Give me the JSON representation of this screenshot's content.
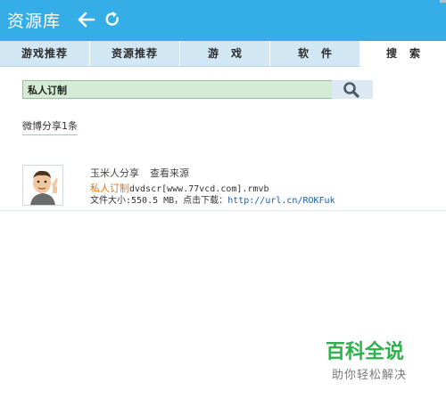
{
  "window": {
    "title": "资源库"
  },
  "tabs": [
    {
      "label": "游戏推荐"
    },
    {
      "label": "资源推荐"
    },
    {
      "label": "游戏"
    },
    {
      "label": "软件"
    },
    {
      "label": "搜索"
    }
  ],
  "active_tab": "搜索",
  "search": {
    "value": "私人订制"
  },
  "results_summary": "微博分享1条",
  "results": [
    {
      "author": "玉米人分享",
      "view_source": "查看来源",
      "title_keyword": "私人订制",
      "title_rest": "dvdscr[www.77vcd.com].rmvb",
      "info_prefix": "文件大小:550.5 MB，点击下载：",
      "info_link": "http://url.cn/ROKFuk"
    }
  ],
  "watermark": {
    "logo_text": "百科全说",
    "caption": "助你轻松解决"
  },
  "colors": {
    "titlebar": "#35aee8",
    "tabbar": "#d2e7f4",
    "search_bg": "#d4ecd4",
    "keyword": "#e77b00",
    "link": "#1a5fa8",
    "watermark_green": "#2bb24c"
  },
  "icons": {
    "back": "arrow-left-icon",
    "refresh": "refresh-icon",
    "search": "magnifier-icon"
  }
}
